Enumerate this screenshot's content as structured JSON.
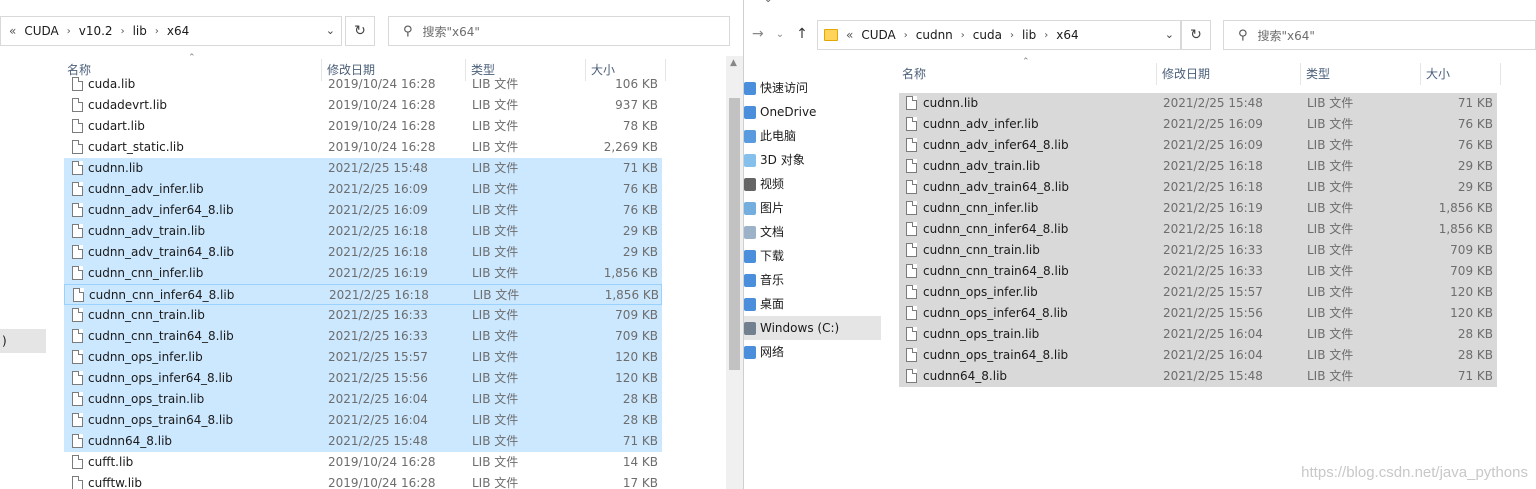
{
  "left": {
    "breadcrumb": [
      "CUDA",
      "v10.2",
      "lib",
      "x64"
    ],
    "breadcrumb_overflow": "«",
    "search_placeholder": "搜索\"x64\"",
    "columns": {
      "name": "名称",
      "date": "修改日期",
      "type": "类型",
      "size": "大小"
    },
    "nav_stub_text": ")",
    "files": [
      {
        "name": "cuda.lib",
        "date": "2019/10/24 16:28",
        "type": "LIB 文件",
        "size": "106 KB",
        "sel": "none"
      },
      {
        "name": "cudadevrt.lib",
        "date": "2019/10/24 16:28",
        "type": "LIB 文件",
        "size": "937 KB",
        "sel": "none"
      },
      {
        "name": "cudart.lib",
        "date": "2019/10/24 16:28",
        "type": "LIB 文件",
        "size": "78 KB",
        "sel": "none"
      },
      {
        "name": "cudart_static.lib",
        "date": "2019/10/24 16:28",
        "type": "LIB 文件",
        "size": "2,269 KB",
        "sel": "none"
      },
      {
        "name": "cudnn.lib",
        "date": "2021/2/25 15:48",
        "type": "LIB 文件",
        "size": "71 KB",
        "sel": "blue"
      },
      {
        "name": "cudnn_adv_infer.lib",
        "date": "2021/2/25 16:09",
        "type": "LIB 文件",
        "size": "76 KB",
        "sel": "blue"
      },
      {
        "name": "cudnn_adv_infer64_8.lib",
        "date": "2021/2/25 16:09",
        "type": "LIB 文件",
        "size": "76 KB",
        "sel": "blue"
      },
      {
        "name": "cudnn_adv_train.lib",
        "date": "2021/2/25 16:18",
        "type": "LIB 文件",
        "size": "29 KB",
        "sel": "blue"
      },
      {
        "name": "cudnn_adv_train64_8.lib",
        "date": "2021/2/25 16:18",
        "type": "LIB 文件",
        "size": "29 KB",
        "sel": "blue"
      },
      {
        "name": "cudnn_cnn_infer.lib",
        "date": "2021/2/25 16:19",
        "type": "LIB 文件",
        "size": "1,856 KB",
        "sel": "blue"
      },
      {
        "name": "cudnn_cnn_infer64_8.lib",
        "date": "2021/2/25 16:18",
        "type": "LIB 文件",
        "size": "1,856 KB",
        "sel": "blue-focus"
      },
      {
        "name": "cudnn_cnn_train.lib",
        "date": "2021/2/25 16:33",
        "type": "LIB 文件",
        "size": "709 KB",
        "sel": "blue"
      },
      {
        "name": "cudnn_cnn_train64_8.lib",
        "date": "2021/2/25 16:33",
        "type": "LIB 文件",
        "size": "709 KB",
        "sel": "blue"
      },
      {
        "name": "cudnn_ops_infer.lib",
        "date": "2021/2/25 15:57",
        "type": "LIB 文件",
        "size": "120 KB",
        "sel": "blue"
      },
      {
        "name": "cudnn_ops_infer64_8.lib",
        "date": "2021/2/25 15:56",
        "type": "LIB 文件",
        "size": "120 KB",
        "sel": "blue"
      },
      {
        "name": "cudnn_ops_train.lib",
        "date": "2021/2/25 16:04",
        "type": "LIB 文件",
        "size": "28 KB",
        "sel": "blue"
      },
      {
        "name": "cudnn_ops_train64_8.lib",
        "date": "2021/2/25 16:04",
        "type": "LIB 文件",
        "size": "28 KB",
        "sel": "blue"
      },
      {
        "name": "cudnn64_8.lib",
        "date": "2021/2/25 15:48",
        "type": "LIB 文件",
        "size": "71 KB",
        "sel": "blue"
      },
      {
        "name": "cufft.lib",
        "date": "2019/10/24 16:28",
        "type": "LIB 文件",
        "size": "14 KB",
        "sel": "none"
      },
      {
        "name": "cufftw.lib",
        "date": "2019/10/24 16:28",
        "type": "LIB 文件",
        "size": "17 KB",
        "sel": "none"
      }
    ]
  },
  "right": {
    "breadcrumb": [
      "CUDA",
      "cudnn",
      "cuda",
      "lib",
      "x64"
    ],
    "breadcrumb_overflow": "«",
    "search_placeholder": "搜索\"x64\"",
    "columns": {
      "name": "名称",
      "date": "修改日期",
      "type": "类型",
      "size": "大小"
    },
    "nav": [
      {
        "label": "快速访问",
        "icon": "quick-access-icon",
        "color": "#2b7bd6"
      },
      {
        "label": "OneDrive",
        "icon": "onedrive-icon",
        "color": "#2b7bd6"
      },
      {
        "label": "此电脑",
        "icon": "this-pc-icon",
        "color": "#3c8ad8"
      },
      {
        "label": "3D 对象",
        "icon": "3d-objects-icon",
        "color": "#6fb5e8"
      },
      {
        "label": "视频",
        "icon": "videos-icon",
        "color": "#4a4a4a"
      },
      {
        "label": "图片",
        "icon": "pictures-icon",
        "color": "#5aa0d8"
      },
      {
        "label": "文档",
        "icon": "documents-icon",
        "color": "#8aa4bf"
      },
      {
        "label": "下载",
        "icon": "downloads-icon",
        "color": "#2b7bd6"
      },
      {
        "label": "音乐",
        "icon": "music-icon",
        "color": "#2b7bd6"
      },
      {
        "label": "桌面",
        "icon": "desktop-icon",
        "color": "#2b7bd6"
      },
      {
        "label": "Windows (C:)",
        "icon": "drive-icon",
        "color": "#5f6f80",
        "active": true
      },
      {
        "label": "网络",
        "icon": "network-icon",
        "color": "#2b7bd6"
      }
    ],
    "files": [
      {
        "name": "cudnn.lib",
        "date": "2021/2/25 15:48",
        "type": "LIB 文件",
        "size": "71 KB"
      },
      {
        "name": "cudnn_adv_infer.lib",
        "date": "2021/2/25 16:09",
        "type": "LIB 文件",
        "size": "76 KB"
      },
      {
        "name": "cudnn_adv_infer64_8.lib",
        "date": "2021/2/25 16:09",
        "type": "LIB 文件",
        "size": "76 KB"
      },
      {
        "name": "cudnn_adv_train.lib",
        "date": "2021/2/25 16:18",
        "type": "LIB 文件",
        "size": "29 KB"
      },
      {
        "name": "cudnn_adv_train64_8.lib",
        "date": "2021/2/25 16:18",
        "type": "LIB 文件",
        "size": "29 KB"
      },
      {
        "name": "cudnn_cnn_infer.lib",
        "date": "2021/2/25 16:19",
        "type": "LIB 文件",
        "size": "1,856 KB"
      },
      {
        "name": "cudnn_cnn_infer64_8.lib",
        "date": "2021/2/25 16:18",
        "type": "LIB 文件",
        "size": "1,856 KB"
      },
      {
        "name": "cudnn_cnn_train.lib",
        "date": "2021/2/25 16:33",
        "type": "LIB 文件",
        "size": "709 KB"
      },
      {
        "name": "cudnn_cnn_train64_8.lib",
        "date": "2021/2/25 16:33",
        "type": "LIB 文件",
        "size": "709 KB"
      },
      {
        "name": "cudnn_ops_infer.lib",
        "date": "2021/2/25 15:57",
        "type": "LIB 文件",
        "size": "120 KB"
      },
      {
        "name": "cudnn_ops_infer64_8.lib",
        "date": "2021/2/25 15:56",
        "type": "LIB 文件",
        "size": "120 KB"
      },
      {
        "name": "cudnn_ops_train.lib",
        "date": "2021/2/25 16:04",
        "type": "LIB 文件",
        "size": "28 KB"
      },
      {
        "name": "cudnn_ops_train64_8.lib",
        "date": "2021/2/25 16:04",
        "type": "LIB 文件",
        "size": "28 KB"
      },
      {
        "name": "cudnn64_8.lib",
        "date": "2021/2/25 15:48",
        "type": "LIB 文件",
        "size": "71 KB"
      }
    ]
  },
  "watermark": "https://blog.csdn.net/java_pythons",
  "colors": {
    "selection_blue": "#cce8ff",
    "selection_grey": "#d9d9d9",
    "header_text": "#4c607a"
  }
}
